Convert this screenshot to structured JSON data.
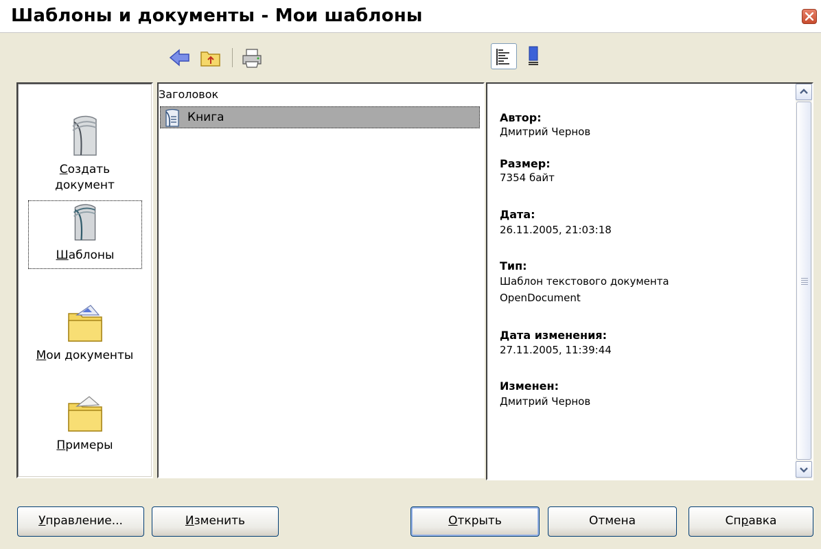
{
  "window": {
    "title": "Шаблоны и документы - Мои шаблоны"
  },
  "toolbar": {
    "icons": [
      "back-icon",
      "up-folder-icon",
      "print-icon"
    ],
    "view_icons": [
      "document-properties-icon",
      "document-preview-icon"
    ]
  },
  "categories": [
    {
      "label_pre": "",
      "label_acc": "С",
      "label_post": "оздать",
      "label_line2": "документ",
      "icon": "new-document-icon"
    },
    {
      "label_pre": "",
      "label_acc": "Ш",
      "label_post": "аблоны",
      "icon": "templates-icon"
    },
    {
      "label_pre": "",
      "label_acc": "М",
      "label_post": "ои документы",
      "icon": "my-documents-folder-icon"
    },
    {
      "label_pre": "",
      "label_acc": "П",
      "label_post": "римеры",
      "icon": "samples-folder-icon"
    }
  ],
  "filelist": {
    "column_header": "Заголовок",
    "items": [
      {
        "label": "Книга",
        "icon": "template-file-icon"
      }
    ]
  },
  "info": {
    "author_label": "Автор:",
    "author_value": "Дмитрий Чернов",
    "size_label": "Размер:",
    "size_value": "7354 байт",
    "date_label": "Дата:",
    "date_value": "26.11.2005, 21:03:18",
    "type_label": "Тип:",
    "type_value_1": "Шаблон текстового документа",
    "type_value_2": "OpenDocument",
    "modified_date_label": "Дата изменения:",
    "modified_date_value": "27.11.2005, 11:39:44",
    "modified_by_label": "Изменен:",
    "modified_by_value": "Дмитрий Чернов"
  },
  "buttons": {
    "manage": {
      "acc": "У",
      "rest": "правление..."
    },
    "edit": {
      "acc": "И",
      "rest": "зменить"
    },
    "open": {
      "acc": "О",
      "rest": "ткрыть"
    },
    "cancel": {
      "label": "Отмена"
    },
    "help": {
      "pre": "Сп",
      "acc": "р",
      "rest": "авка"
    }
  },
  "colors": {
    "dialog_bg": "#ECE9D8",
    "selection": "#A9A9A9",
    "button_border": "#003C74"
  }
}
